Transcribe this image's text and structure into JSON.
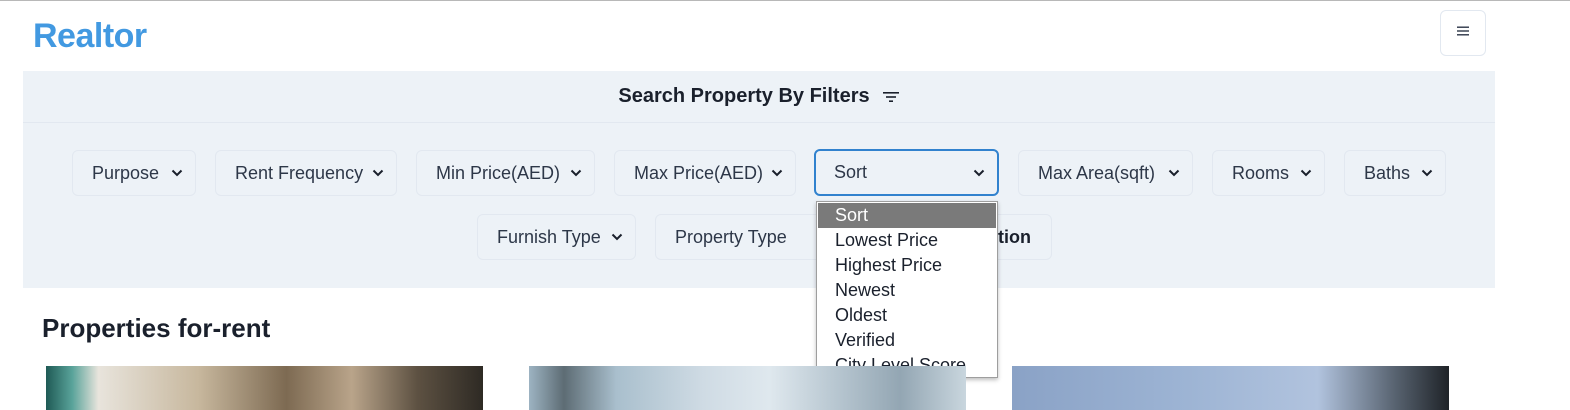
{
  "brand": {
    "name": "Realtor"
  },
  "header": {
    "menu_icon": "hamburger-icon"
  },
  "filters": {
    "title": "Search Property By Filters",
    "title_icon": "filter-icon",
    "selects": {
      "purpose": "Purpose",
      "rent_frequency": "Rent Frequency",
      "min_price": "Min Price(AED)",
      "max_price": "Max Price(AED)",
      "sort": "Sort",
      "max_area": "Max Area(sqft)",
      "rooms": "Rooms",
      "baths": "Baths",
      "furnish_type": "Furnish Type",
      "property_type": "Property Type"
    },
    "location_button_partial": "tion",
    "sort_options": [
      "Sort",
      "Lowest Price",
      "Highest Price",
      "Newest",
      "Oldest",
      "Verified",
      "City Level Score"
    ],
    "sort_selected_index": 0
  },
  "main": {
    "section_title": "Properties for-rent"
  },
  "colors": {
    "brand": "#4299e1",
    "panel_bg": "#edf2f7",
    "focus_border": "#3182ce",
    "dropdown_selected": "#7a7a7a"
  }
}
